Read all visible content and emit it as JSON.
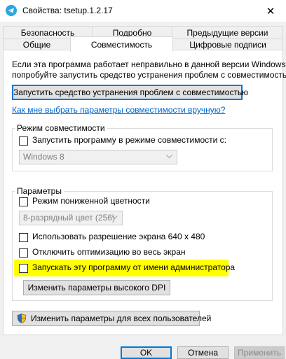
{
  "window": {
    "title": "Свойства: tsetup.1.2.17",
    "close_glyph": "✕",
    "icon": "telegram-icon",
    "accent": "#0078d7"
  },
  "tabs_row1": [
    {
      "label": "Безопасность"
    },
    {
      "label": "Подробно"
    },
    {
      "label": "Предыдущие версии"
    }
  ],
  "tabs_row2": [
    {
      "label": "Общие"
    },
    {
      "label": "Совместимость",
      "active": true
    },
    {
      "label": "Цифровые подписи"
    }
  ],
  "panel": {
    "intro_line1": "Если эта программа работает неправильно в данной версии Windows,",
    "intro_line2": "попробуйте запустить средство устранения проблем с совместимостью.",
    "troubleshooter_button": "Запустить средство устранения проблем с совместимостью",
    "manual_link": "Как мне выбрать параметры совместимости вручную?",
    "compat_group": {
      "label": "Режим совместимости",
      "checkbox_label": "Запустить программу в режиме совместимости с:",
      "os_select_value": "Windows 8"
    },
    "params_group": {
      "label": "Параметры",
      "reduced_color_label": "Режим пониженной цветности",
      "color_select_value": "8-разрядный цвет (256)",
      "resolution_label": "Использовать разрешение экрана 640 х 480",
      "fullscreen_opt_label": "Отключить оптимизацию во весь экран",
      "run_as_admin_label": "Запускать эту программу от имени администратора",
      "high_dpi_button": "Изменить параметры высокого DPI"
    },
    "all_users_button": "Изменить параметры для всех пользователей"
  },
  "footer": {
    "ok": "OK",
    "cancel": "Отмена",
    "apply": "Применить"
  },
  "highlight_color": "#ffff00"
}
